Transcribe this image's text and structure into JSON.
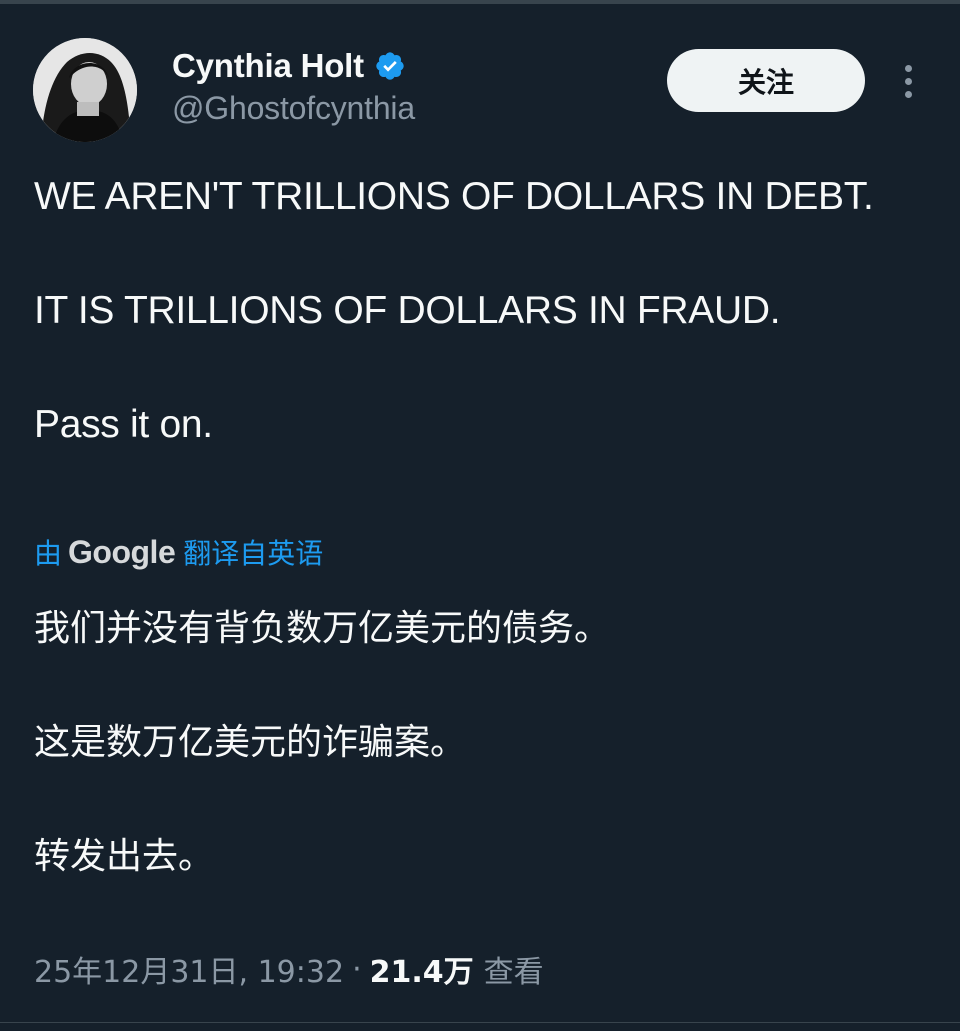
{
  "author": {
    "display_name": "Cynthia Holt",
    "handle": "@Ghostofcynthia",
    "verified": true
  },
  "follow_button": {
    "label": "关注"
  },
  "more_menu": {
    "icon": "more-vertical-icon"
  },
  "tweet": {
    "paragraphs": [
      "WE AREN'T TRILLIONS OF DOLLARS IN DEBT.",
      "IT IS TRILLIONS OF DOLLARS IN FRAUD.",
      "Pass it on."
    ]
  },
  "translation": {
    "prefix": "由",
    "provider": "Google",
    "suffix": "翻译自英语",
    "paragraphs": [
      "我们并没有背负数万亿美元的债务。",
      "这是数万亿美元的诈骗案。",
      "转发出去。"
    ]
  },
  "meta": {
    "timestamp": "25年12月31日, 19:32",
    "separator": "·",
    "views_count": "21.4万",
    "views_label": "查看"
  },
  "colors": {
    "background": "#15202b",
    "text_primary": "#f7f9f9",
    "text_secondary": "#8b98a5",
    "accent": "#1d9bf0",
    "follow_button_bg": "#eff3f4"
  }
}
